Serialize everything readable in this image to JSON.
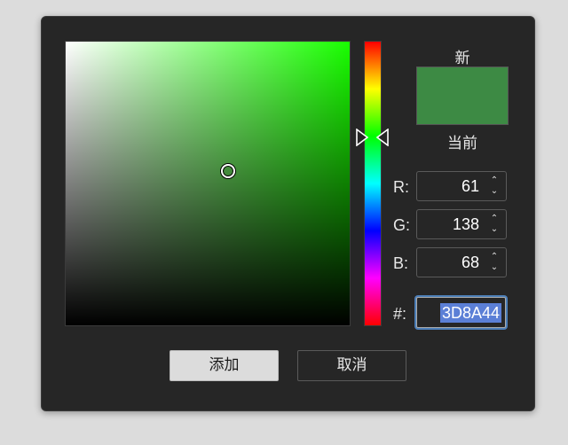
{
  "dialog": {
    "new_label": "新",
    "current_label": "当前",
    "swatch_color": "#3D8A44",
    "field_hue_color": "#19ff00",
    "channels": [
      {
        "label": "R:",
        "value": "61"
      },
      {
        "label": "G:",
        "value": "138"
      },
      {
        "label": "B:",
        "value": "68"
      }
    ],
    "hex": {
      "label": "#:",
      "value": "3D8A44"
    },
    "buttons": {
      "add_label": "添加",
      "cancel_label": "取消"
    }
  }
}
